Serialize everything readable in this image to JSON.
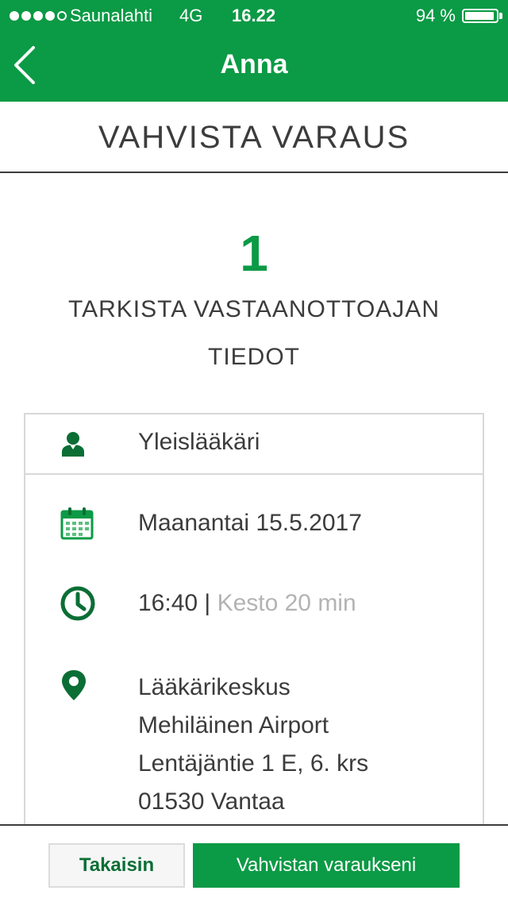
{
  "status_bar": {
    "carrier": "Saunalahti",
    "network": "4G",
    "time": "16.22",
    "battery_percent": "94 %",
    "battery_level": 0.94,
    "signal_bars": 4
  },
  "nav": {
    "title": "Anna",
    "back_icon": "chevron-left-icon"
  },
  "page": {
    "title": "VAHVISTA VARAUS"
  },
  "step": {
    "number": "1",
    "title_line1": "TARKISTA VASTAANOTTOAJAN",
    "title_line2": "TIEDOT"
  },
  "details": {
    "doctor_type": "Yleislääkäri",
    "date": "Maanantai 15.5.2017",
    "time": "16:40",
    "separator": "|",
    "duration": "Kesto 20 min",
    "location_line1": "Lääkärikeskus",
    "location_line2": "Mehiläinen Airport",
    "location_line3": "Lentäjäntie 1 E, 6. krs",
    "location_line4": "01530 Vantaa"
  },
  "footer": {
    "back_label": "Takaisin",
    "confirm_label": "Vahvistan varaukseni"
  },
  "colors": {
    "brand_green": "#0b9a45",
    "dark_green": "#0b6e35",
    "text": "#3c3c3c",
    "muted": "#b3b3b3"
  }
}
